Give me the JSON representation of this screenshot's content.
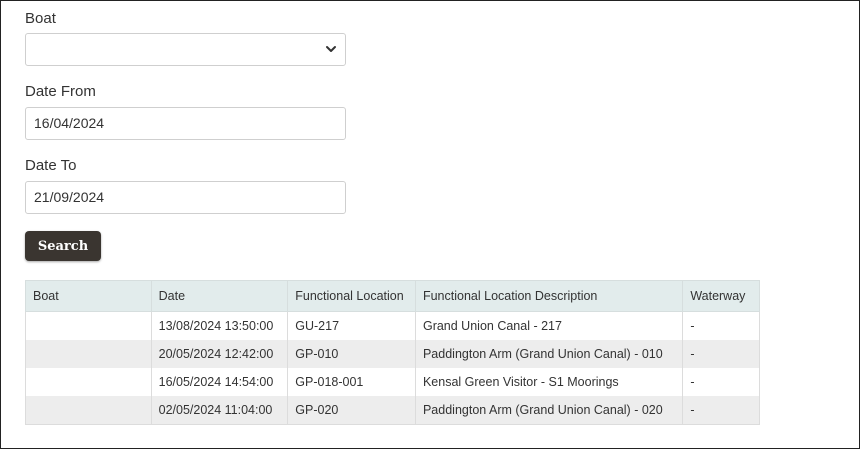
{
  "form": {
    "boat_label": "Boat",
    "boat_value": "",
    "date_from_label": "Date From",
    "date_from_value": "16/04/2024",
    "date_to_label": "Date To",
    "date_to_value": "21/09/2024",
    "search_label": "Search"
  },
  "table": {
    "headers": [
      "Boat",
      "Date",
      "Functional Location",
      "Functional Location Description",
      "Waterway"
    ],
    "rows": [
      {
        "boat": "",
        "date": "13/08/2024 13:50:00",
        "location": "GU-217",
        "description": "Grand Union Canal - 217",
        "waterway": "-"
      },
      {
        "boat": "",
        "date": "20/05/2024 12:42:00",
        "location": "GP-010",
        "description": "Paddington Arm (Grand Union Canal) - 010",
        "waterway": "-"
      },
      {
        "boat": "",
        "date": "16/05/2024 14:54:00",
        "location": "GP-018-001",
        "description": "Kensal Green Visitor - S1 Moorings",
        "waterway": "-"
      },
      {
        "boat": "",
        "date": "02/05/2024 11:04:00",
        "location": "GP-020",
        "description": "Paddington Arm (Grand Union Canal) - 020",
        "waterway": "-"
      }
    ]
  },
  "icons": {
    "select_chevron": "chevron-down-icon"
  }
}
